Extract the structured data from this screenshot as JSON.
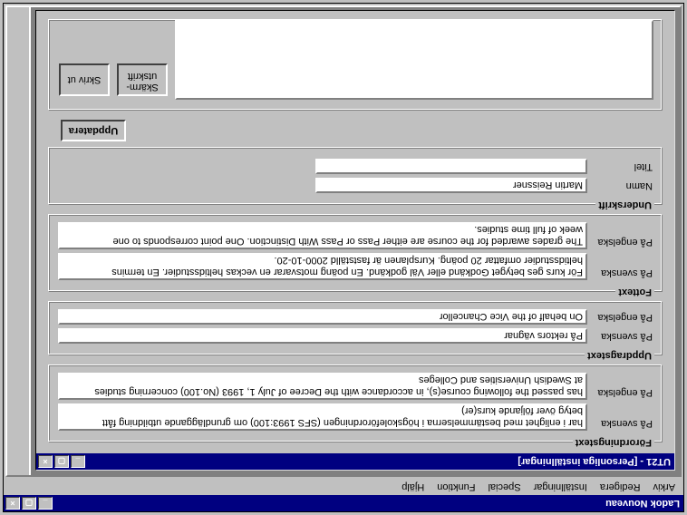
{
  "outer": {
    "title": "Ladok Nouveau",
    "menu": [
      "Arkiv",
      "Redigera",
      "Inställningar",
      "Special",
      "Funktion",
      "Hjälp"
    ]
  },
  "child": {
    "title": "UT21 - [Personliga inställningar]"
  },
  "groups": {
    "forordning": {
      "legend": "Förordningstext",
      "svenska_label": "På svenska",
      "svenska_value": "har i enlighet med bestämmelserna i högskoleförordningen (SFS 1993:100) om grundläggande utbildning fått\nbetyg över följande kurs(er)",
      "engelska_label": "På engelska",
      "engelska_value": "has passed the following course(s), in accordance with the Decree of July 1, 1993 (No.100) concerning studies\nat Swedish Universities and Colleges"
    },
    "uppdrag": {
      "legend": "Uppdragstext",
      "svenska_label": "På svenska",
      "svenska_value": "På rektors vägnar",
      "engelska_label": "På engelska",
      "engelska_value": "On behalf of the Vice Chancellor"
    },
    "fottext": {
      "legend": "Fottext",
      "svenska_label": "På svenska",
      "svenska_value": "För kurs ges betyget Godkänd eller Väl godkänd. En poäng motsvarar en veckas heltidsstudier. En termins\nheltidsstudier omfattar 20 poäng. Kursplanen är fastställd 2000-10-20.",
      "engelska_label": "På engelska",
      "engelska_value": "The grades awarded for the course are either Pass or Pass With Distinction. One point corresponds to one\nweek of full time studies."
    },
    "underskrift": {
      "legend": "Underskrift",
      "namn_label": "Namn",
      "namn_value": "Martin Reissner",
      "titel_label": "Titel",
      "titel_value": ""
    }
  },
  "buttons": {
    "uppdatera": "Uppdatera",
    "skarm_utskrift_line1": "Skärm-",
    "skarm_utskrift_line2": "utskrift",
    "skrivut": "Skriv ut"
  }
}
